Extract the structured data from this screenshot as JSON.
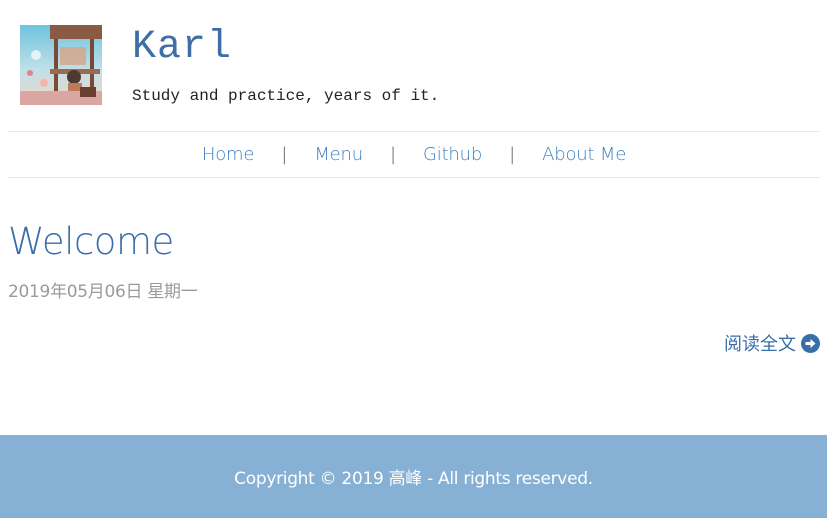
{
  "header": {
    "title": "Karl",
    "tagline": "Study and practice, years of it."
  },
  "nav": {
    "items": [
      {
        "label": "Home"
      },
      {
        "label": "Menu"
      },
      {
        "label": "Github"
      },
      {
        "label": "About Me"
      }
    ],
    "separator": "|"
  },
  "post": {
    "title": "Welcome",
    "date": "2019年05月06日 星期一",
    "read_more_label": "阅读全文",
    "read_more_icon": "arrow-circle-right-icon"
  },
  "footer": {
    "text": "Copyright © 2019 高峰 - All rights reserved."
  },
  "colors": {
    "accent": "#3f7fc0",
    "title": "#3a6ea8",
    "footer_bg": "#86b0d4",
    "date": "#9a9a9a"
  }
}
